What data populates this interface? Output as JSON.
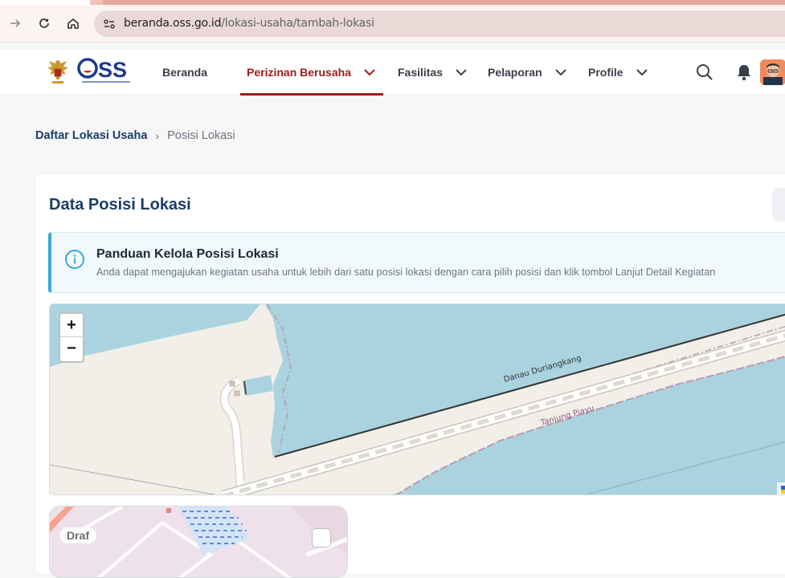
{
  "browser": {
    "url_host": "beranda.oss.go.id",
    "url_path": "/lokasi-usaha/tambah-lokasi"
  },
  "header": {
    "logo_text": "OSS",
    "nav": [
      {
        "label": "Beranda",
        "active": false,
        "dropdown": false
      },
      {
        "label": "Perizinan Berusaha",
        "active": true,
        "dropdown": true
      },
      {
        "label": "Fasilitas",
        "active": false,
        "dropdown": true
      },
      {
        "label": "Pelaporan",
        "active": false,
        "dropdown": true
      },
      {
        "label": "Profile",
        "active": false,
        "dropdown": true
      }
    ],
    "icons": [
      "search-icon",
      "bell-icon",
      "avatar"
    ]
  },
  "breadcrumb": {
    "parent": "Daftar Lokasi Usaha",
    "separator": "›",
    "current": "Posisi Lokasi"
  },
  "card": {
    "title": "Data Posisi Lokasi",
    "notice": {
      "title": "Panduan Kelola Posisi Lokasi",
      "text": "Anda dapat mengajukan kegiatan usaha untuk lebih dari satu posisi lokasi dengan cara pilih posisi dan klik tombol Lanjut Detail Kegiatan"
    },
    "map": {
      "zoom_in": "+",
      "zoom_out": "−",
      "labels": {
        "danau": "Danau Duriangkang",
        "tanjung": "Tanjung Piayu"
      }
    },
    "location_card": {
      "status": "Draf"
    }
  },
  "colors": {
    "brand_red": "#9e1b1b",
    "brand_blue": "#1a3d6b",
    "water": "#aad3df",
    "land": "#f2efe9",
    "notice_accent": "#38a8d8"
  }
}
